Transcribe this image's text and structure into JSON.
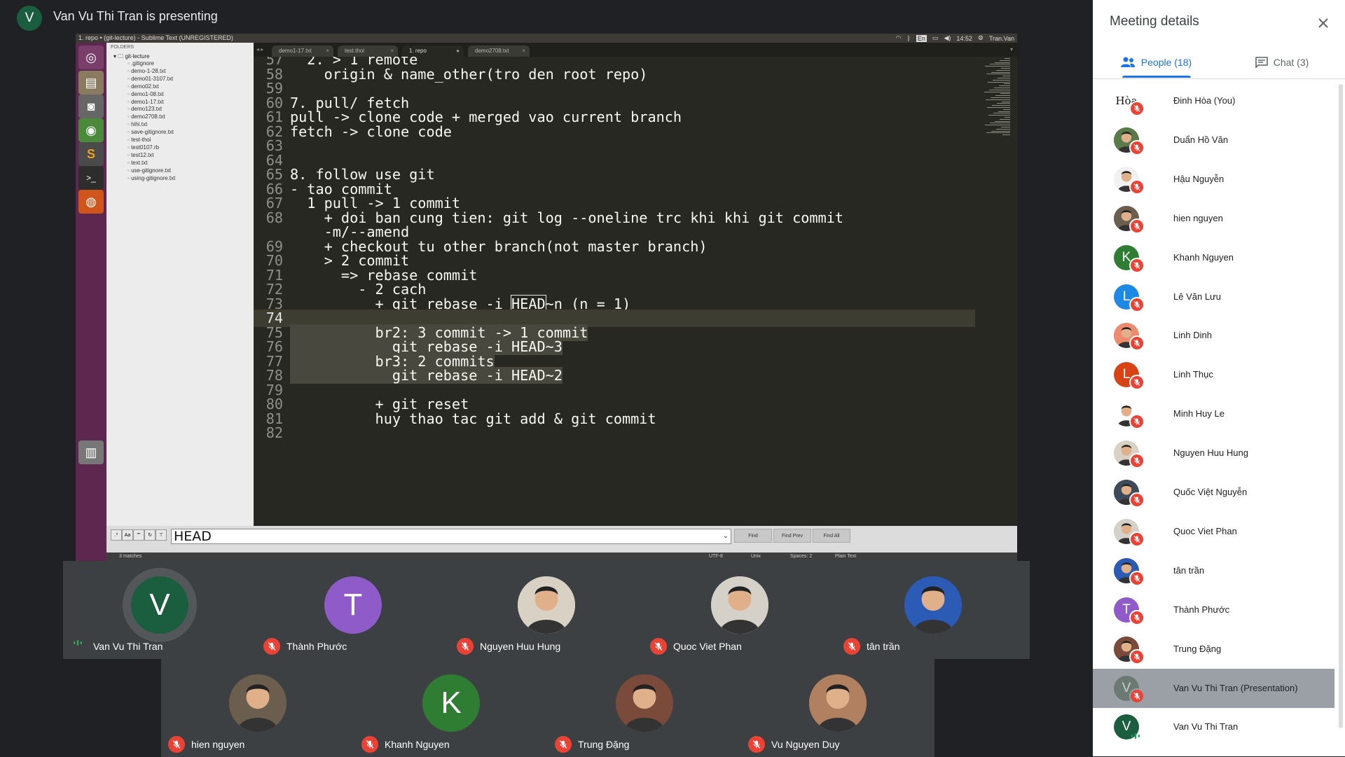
{
  "presenter": {
    "initial": "V",
    "title": "Van Vu Thi Tran is presenting"
  },
  "screen": {
    "window_title": "1. repo • (git-lecture) - Sublime Text (UNREGISTERED)",
    "tray": {
      "lang": "En",
      "time": "14:52",
      "user": "Tran.Van"
    },
    "sidebar": {
      "header": "FOLDERS",
      "folder": "git-lecture",
      "files": [
        ".gitignore",
        "demo-1-28.txt",
        "demo01-3107.txt",
        "demo02.txt",
        "demo1-08.txt",
        "demo1-17.txt",
        "demo123.txt",
        "demo2708.txt",
        "hihi.txt",
        "save-gitignore.txt",
        "test-thoi",
        "test0107.rb",
        "test12.txt",
        "text.txt",
        "use-gitignore.txt",
        "using-gitignore.txt"
      ]
    },
    "tabs": [
      "demo1-17.txt",
      "test.thoi",
      "1. repo",
      "demo2708.txt"
    ],
    "code_lines": [
      {
        "n": "57",
        "t": "  2. > 1 remote"
      },
      {
        "n": "58",
        "t": "    origin & name_other(tro den root repo)"
      },
      {
        "n": "59",
        "t": ""
      },
      {
        "n": "60",
        "t": "7. pull/ fetch"
      },
      {
        "n": "61",
        "t": "pull -> clone code + merged vao current branch"
      },
      {
        "n": "62",
        "t": "fetch -> clone code"
      },
      {
        "n": "63",
        "t": ""
      },
      {
        "n": "64",
        "t": ""
      },
      {
        "n": "65",
        "t": "8. follow use git"
      },
      {
        "n": "66",
        "t": "- tao commit"
      },
      {
        "n": "67",
        "t": "  1 pull -> 1 commit"
      },
      {
        "n": "68",
        "t": "    + doi ban cung tien: git log --oneline trc khi khi git commit"
      },
      {
        "n": "",
        "t": "    -m/--amend"
      },
      {
        "n": "69",
        "t": "    + checkout tu other branch(not master branch)"
      },
      {
        "n": "70",
        "t": "    > 2 commit"
      },
      {
        "n": "71",
        "t": "      => rebase commit"
      },
      {
        "n": "72",
        "t": "        - 2 cach"
      },
      {
        "n": "73",
        "t": "          + git rebase -i HEAD~n (n = 1)"
      },
      {
        "n": "74",
        "t": ""
      },
      {
        "n": "75",
        "t": "          br2: 3 commit -> 1 commit"
      },
      {
        "n": "76",
        "t": "            git rebase -i HEAD~3"
      },
      {
        "n": "77",
        "t": "          br3: 2 commits"
      },
      {
        "n": "78",
        "t": "            git rebase -i HEAD~2"
      },
      {
        "n": "79",
        "t": ""
      },
      {
        "n": "80",
        "t": "          + git reset"
      },
      {
        "n": "81",
        "t": "          huy thao tac git add & git commit"
      },
      {
        "n": "82",
        "t": ""
      }
    ],
    "find": {
      "value": "HEAD",
      "buttons": [
        "Find",
        "Find Prev",
        "Find All"
      ],
      "options": [
        ".*",
        "Aa",
        "\"\""
      ]
    },
    "status": {
      "matches": "3 matches",
      "encoding": "UTF-8",
      "line_endings": "Unix",
      "spaces": "Spaces: 2",
      "syntax": "Plain Text"
    }
  },
  "tiles": [
    {
      "name": "Van Vu Thi Tran",
      "initial": "V",
      "color": "#1b5e3f",
      "speaking": true
    },
    {
      "name": "Thành Phước",
      "initial": "T",
      "color": "#8e5bc9",
      "speaking": false
    },
    {
      "name": "Nguyen Huu Hung",
      "initial": "",
      "color": "#d9d2c4",
      "speaking": false
    },
    {
      "name": "Quoc Viet Phan",
      "initial": "",
      "color": "#d6d1c8",
      "speaking": false
    },
    {
      "name": "tân trần",
      "initial": "",
      "color": "#2b5bb5",
      "speaking": false
    },
    {
      "name": "hien nguyen",
      "initial": "",
      "color": "#6b5e4e",
      "speaking": false
    },
    {
      "name": "Khanh Nguyen",
      "initial": "K",
      "color": "#2e7d32",
      "speaking": false
    },
    {
      "name": "Trung Đặng",
      "initial": "",
      "color": "#7a4a3a",
      "speaking": false
    },
    {
      "name": "Vu Nguyen Duy",
      "initial": "",
      "color": "#b08060",
      "speaking": false
    }
  ],
  "panel": {
    "title": "Meeting details",
    "tab_people": "People (18)",
    "tab_chat": "Chat (3)",
    "people": [
      {
        "name": "Đinh Hòa (You)",
        "initial": "Hòa",
        "color": "#ffffff",
        "text": "#111",
        "muted": true
      },
      {
        "name": "Duẩn Hồ Văn",
        "initial": "",
        "color": "#5a7a4a",
        "text": "#fff",
        "muted": true
      },
      {
        "name": "Hậu Nguyễn",
        "initial": "",
        "color": "#f1f1f1",
        "text": "#111",
        "muted": true
      },
      {
        "name": "hien nguyen",
        "initial": "",
        "color": "#6b5e4e",
        "text": "#fff",
        "muted": true
      },
      {
        "name": "Khanh Nguyen",
        "initial": "K",
        "color": "#2e7d32",
        "text": "#fff",
        "muted": true
      },
      {
        "name": "Lê Văn Lưu",
        "initial": "L",
        "color": "#1e88e5",
        "text": "#fff",
        "muted": true
      },
      {
        "name": "Linh Dinh",
        "initial": "",
        "color": "#f08a6e",
        "text": "#fff",
        "muted": true
      },
      {
        "name": "Linh Thục",
        "initial": "L",
        "color": "#d84315",
        "text": "#fff",
        "muted": true
      },
      {
        "name": "Minh Huy Le",
        "initial": "",
        "color": "#ffffff",
        "text": "#c00",
        "muted": true
      },
      {
        "name": "Nguyen Huu Hung",
        "initial": "",
        "color": "#d9d2c4",
        "text": "#fff",
        "muted": true
      },
      {
        "name": "Quốc Việt Nguyễn",
        "initial": "",
        "color": "#3d4a5a",
        "text": "#fff",
        "muted": true
      },
      {
        "name": "Quoc Viet Phan",
        "initial": "",
        "color": "#d6d1c8",
        "text": "#fff",
        "muted": true
      },
      {
        "name": "tân trần",
        "initial": "",
        "color": "#2b5bb5",
        "text": "#fff",
        "muted": true
      },
      {
        "name": "Thành Phước",
        "initial": "T",
        "color": "#8e5bc9",
        "text": "#fff",
        "muted": true
      },
      {
        "name": "Trung Đặng",
        "initial": "",
        "color": "#7a4a3a",
        "text": "#fff",
        "muted": true
      },
      {
        "name": "Van Vu Thi Tran (Presentation)",
        "initial": "V",
        "color": "#6b7a72",
        "text": "#c8d0cc",
        "muted": true,
        "highlight": true
      },
      {
        "name": "Van Vu Thi Tran",
        "initial": "V",
        "color": "#1b5e3f",
        "text": "#fff",
        "muted": false,
        "speaking": true
      }
    ]
  },
  "colors": {
    "accent": "#1a73e8",
    "muted_red": "#ea4335",
    "meet_bg": "#202124",
    "tile_bg": "#3c4043"
  }
}
